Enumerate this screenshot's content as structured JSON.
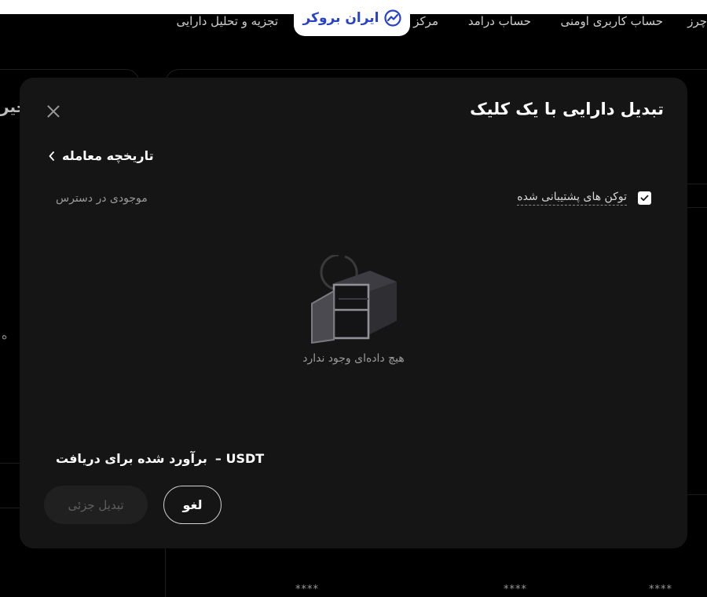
{
  "logo": {
    "text": "ایران بروکر"
  },
  "nav": {
    "items": [
      "چرز",
      "حساب کاربری اومنی",
      "حساب درامد",
      "مرکز",
      "تجزیه و تحلیل دارایی"
    ]
  },
  "background": {
    "left_fragment": "خیر",
    "side_fragment": "ه",
    "masked_values": [
      "****",
      "****",
      "****"
    ]
  },
  "modal": {
    "title": "تبدیل دارایی با یک کلیک",
    "history_label": "تاریخچه معامله",
    "supported_tokens_label": "توکن های پشتیبانی شده",
    "supported_tokens_checked": true,
    "available_label": "موجودی در دسترس",
    "empty_text": "هیچ داده‌ای وجود ندارد",
    "estimate_label": "برآورد شده برای دریافت",
    "estimate_value": "USDT  –",
    "cancel_label": "لغو",
    "partial_convert_label": "تبدیل جزئی"
  },
  "colors": {
    "page_bg": "#000000",
    "modal_bg": "#151515",
    "logo_blue": "#2742c9",
    "muted_text": "#9a9a9a",
    "disabled_button_bg": "#202020"
  },
  "icons": [
    "logo-mark-icon",
    "close-icon",
    "chevron-left-icon",
    "check-icon",
    "empty-box-icon"
  ]
}
